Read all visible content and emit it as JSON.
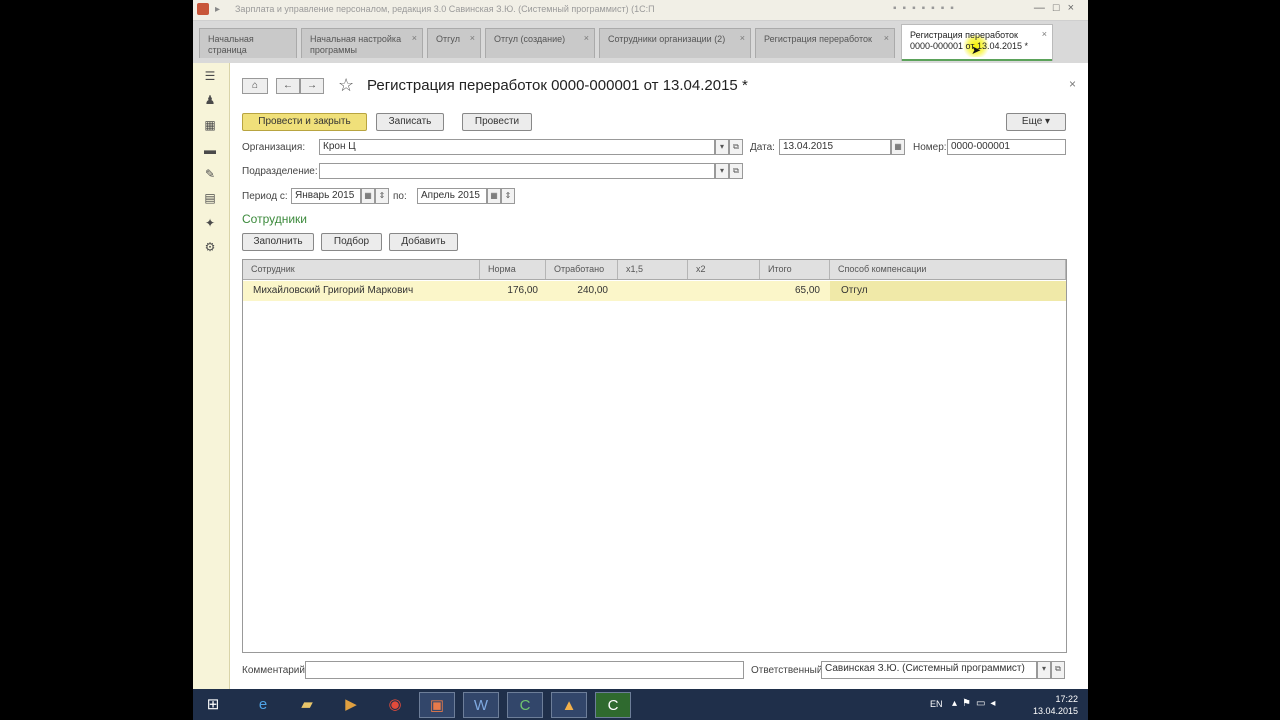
{
  "window": {
    "title": "Зарплата и управление персоналом, редакция 3.0 Савинская З.Ю. (Системный программист) (1С:Предприятие)",
    "controls": [
      "—",
      "□",
      "×"
    ]
  },
  "tabs": [
    {
      "label": "Начальная страница"
    },
    {
      "label": "Начальная настройка программы"
    },
    {
      "label": "Отгул"
    },
    {
      "label": "Отгул (создание)"
    },
    {
      "label": "Сотрудники организации (2)"
    },
    {
      "label": "Регистрация переработок"
    },
    {
      "label": "Регистрация переработок 0000-000001 от 13.04.2015 *",
      "active": true
    }
  ],
  "form": {
    "title": "Регистрация переработок 0000-000001 от 13.04.2015 *",
    "nav": {
      "home_icon": "home-icon",
      "back": "←",
      "forward": "→"
    },
    "actions": {
      "post_and_close": "Провести и закрыть",
      "save": "Записать",
      "post": "Провести",
      "more": "Еще"
    },
    "fields": {
      "organization_label": "Организация:",
      "organization_value": "Крон Ц",
      "date_label": "Дата:",
      "date_value": "13.04.2015",
      "number_label": "Номер:",
      "number_value": "0000-000001",
      "department_label": "Подразделение:",
      "department_value": "",
      "period_from_label": "Период с:",
      "period_from_value": "Январь 2015",
      "period_to_label": "по:",
      "period_to_value": "Апрель 2015"
    },
    "employees_section": {
      "title": "Сотрудники",
      "fill": "Заполнить",
      "pick": "Подбор",
      "add": "Добавить"
    },
    "table": {
      "columns": [
        "Сотрудник",
        "Норма",
        "Отработано",
        "x1,5",
        "x2",
        "Итого",
        "Способ компенсации"
      ],
      "rows": [
        {
          "employee": "Михайловский Григорий Маркович",
          "norm": "176,00",
          "worked": "240,00",
          "x15": "",
          "x2": "",
          "total": "65,00",
          "compensation": "Отгул"
        }
      ]
    },
    "footer": {
      "comment_label": "Комментарий:",
      "comment_value": "",
      "responsible_label": "Ответственный:",
      "responsible_value": "Савинская З.Ю. (Системный программист)"
    }
  },
  "taskbar": {
    "items": [
      "start-icon",
      "ie-icon",
      "explorer-icon",
      "media-icon",
      "chrome-icon",
      "app-icon",
      "word-icon",
      "1c-icon",
      "installer-icon",
      "1c-icon-2"
    ],
    "tray": {
      "lang": "EN",
      "time": "17:22",
      "date": "13.04.2015"
    }
  },
  "colors": {
    "accent_green": "#3c8a3c",
    "primary_button": "#f0e07a",
    "selected_row": "#fbf6c9",
    "side_panel": "#f7f4d9"
  }
}
